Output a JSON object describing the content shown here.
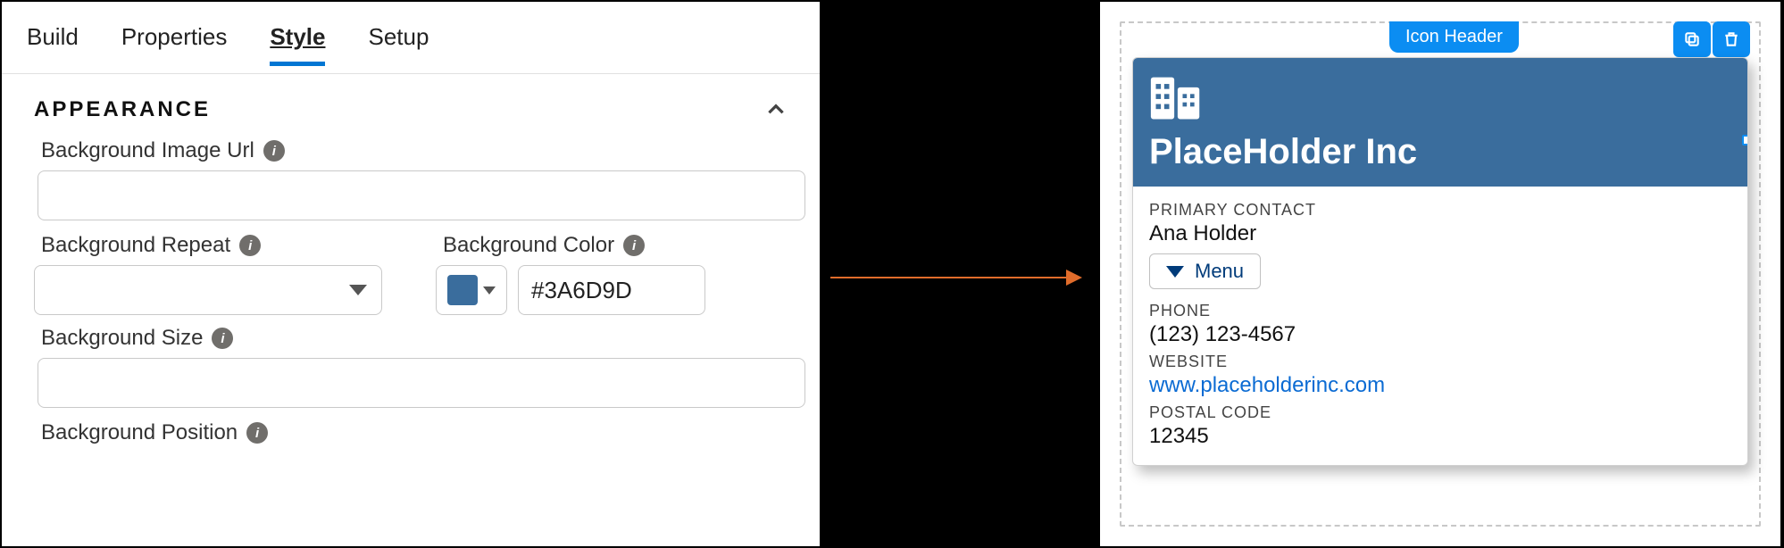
{
  "tabs": {
    "build": "Build",
    "properties": "Properties",
    "style": "Style",
    "setup": "Setup"
  },
  "appearance": {
    "title": "APPEARANCE",
    "bg_image_url_label": "Background Image Url",
    "bg_image_url_value": "",
    "bg_repeat_label": "Background Repeat",
    "bg_repeat_value": "",
    "bg_color_label": "Background Color",
    "bg_color_hex": "#3A6D9D",
    "bg_size_label": "Background Size",
    "bg_size_value": "",
    "bg_position_label": "Background Position"
  },
  "preview": {
    "component_label": "Icon Header",
    "header_title": "PlaceHolder Inc",
    "primary_contact_label": "PRIMARY CONTACT",
    "primary_contact_value": "Ana Holder",
    "menu_label": "Menu",
    "phone_label": "PHONE",
    "phone_value": "(123) 123-4567",
    "website_label": "WEBSITE",
    "website_value": "www.placeholderinc.com",
    "postal_label": "POSTAL CODE",
    "postal_value": "12345"
  }
}
